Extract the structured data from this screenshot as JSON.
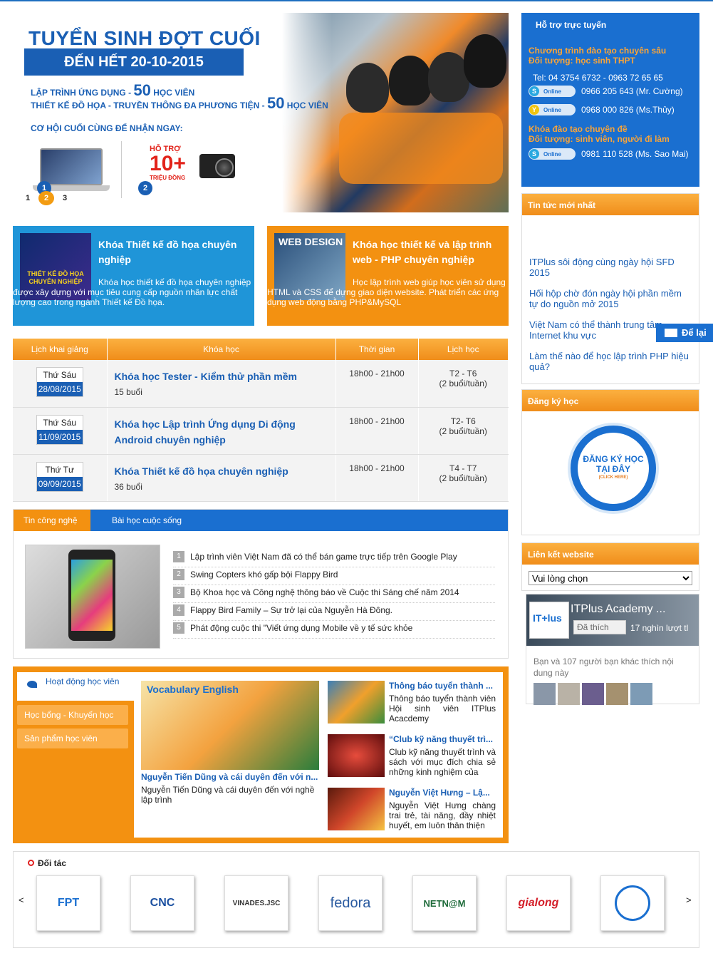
{
  "banner": {
    "title": "TUYỂN SINH ĐỢT CUỐI",
    "deadline": "ĐẾN HẾT 20-10-2015",
    "line1_prefix": "LẬP TRÌNH ỨNG DỤNG - ",
    "line1_num": "50",
    "line1_suffix": " HỌC VIÊN",
    "line2_prefix": "THIẾT KẾ ĐỒ HỌA - TRUYỀN THÔNG ĐA PHƯƠNG TIỆN - ",
    "line2_num": "50",
    "line2_suffix": " HỌC VIÊN",
    "chance": "CƠ HỘI CUỐI CÙNG ĐỂ NHẬN NGAY:",
    "gift1_num": "1",
    "gift2_num": "2",
    "support_text": "HỖ TRỢ",
    "support_amount": "10+",
    "support_unit": "TRIỆU ĐỒNG",
    "pager": [
      "1",
      "2",
      "3"
    ]
  },
  "support": {
    "title": "Hỗ trợ trực tuyến",
    "program1": "Chương trình đào tạo chuyên sâu",
    "target1": "Đối tượng: học sinh THPT",
    "tel": "Tel: 04 3754 6732 - 0963 72 65 65",
    "badge": "Online",
    "contact1": "0966 205 643 (Mr. Cường)",
    "contact2": "0968 000 826 (Ms.Thủy)",
    "program2": "Khóa đào tạo chuyên đề",
    "target2": "Đối tượng: sinh viên, người đi làm",
    "contact3": "0981 110 528 (Ms. Sao Mai)"
  },
  "news": {
    "title": "Tin tức mới nhất",
    "items": [
      "ITPlus sôi động cùng ngày hội SFD 2015",
      "Hối hộp chờ đón ngày hội phần mềm tự do nguồn mở 2015",
      "Việt Nam có thể thành trung tâm Internet khu vực",
      "Làm thế nào để học lập trình PHP hiệu quả?"
    ]
  },
  "send": {
    "label": "Để lại"
  },
  "register": {
    "title": "Đăng ký học",
    "button_line1": "ĐĂNG KÝ HỌC",
    "button_line2": "TẠI ĐÂY",
    "button_sub": "(CLICK HERE)"
  },
  "links": {
    "title": "Liên kết website",
    "select_value": "Vui lòng chọn"
  },
  "facebook": {
    "logo": "IT+lus",
    "name": "ITPlus Academy ...",
    "like": "Đã thích",
    "count": "17 nghìn lượt tl",
    "friends": "Bạn và 107 người bạn khác thích nội dung này"
  },
  "promo": [
    {
      "img_text": "THIẾT KẾ ĐỒ HỌA CHUYÊN NGHIỆP",
      "title": "Khóa Thiết kế đồ họa chuyên nghiệp",
      "desc": "Khóa học thiết kế đồ họa chuyên nghiệp được xây dựng với mục tiêu cung cấp nguồn nhân lực chất lượng cao trong ngành Thiết kế Đồ họa."
    },
    {
      "img_text": "WEB DESIGN",
      "title": "Khóa học thiết kế và lập trình web - PHP chuyên nghiệp",
      "desc": "Học lập trình web giúp học viên sử dụng HTML và CSS để dựng giao diện website. Phát triển các ứng dụng web động bằng PHP&MySQL"
    }
  ],
  "schedule": {
    "headers": [
      "Lịch khai giảng",
      "Khóa học",
      "Thời gian",
      "Lịch học"
    ],
    "rows": [
      {
        "day": "Thứ Sáu",
        "date": "28/08/2015",
        "course": "Khóa học Tester - Kiểm thử phần mềm",
        "sessions": "15 buổi",
        "time": "18h00 - 21h00",
        "days": "T2 - T6",
        "freq": "(2 buổi/tuần)"
      },
      {
        "day": "Thứ Sáu",
        "date": "11/09/2015",
        "course": "Khóa học Lập trình Ứng dụng Di động Android chuyên nghiệp",
        "sessions": "",
        "time": "18h00 - 21h00",
        "days": "T2- T6",
        "freq": "(2 buổi/tuần)"
      },
      {
        "day": "Thứ Tư",
        "date": "09/09/2015",
        "course": "Khóa Thiết kế đồ họa chuyên nghiệp",
        "sessions": "36 buổi",
        "time": "18h00 - 21h00",
        "days": "T4 - T7",
        "freq": "(2 buổi/tuần)"
      }
    ]
  },
  "tech": {
    "tab1": "Tin công nghệ",
    "tab2": "Bài học cuộc sống",
    "items": [
      "Lập trình viên Việt Nam đã có thể bán game trực tiếp trên Google Play",
      "Swing Copters khó gấp bội Flappy Bird",
      "Bộ Khoa học và Công nghệ thông báo về Cuộc thi Sáng chế năm 2014",
      "Flappy Bird Family – Sự trở lại của Nguyễn Hà Đông.",
      "Phát động cuộc thi \"Viết ứng dụng Mobile về y tế sức khỏe"
    ]
  },
  "activities": {
    "tab_active": "Hoạt động học viên",
    "tab2": "Học bổng - Khuyến học",
    "tab3": "Sản phẩm học viên",
    "feature_image_text": "Vocabulary English",
    "feature_title": "Nguyễn Tiến Dũng và cái duyên đến với n...",
    "feature_desc": "Nguyễn Tiến Dũng và cái duyên đến với nghề lập trình",
    "items": [
      {
        "title": "Thông báo tuyển thành ...",
        "desc": "Thông báo tuyển thành viên Hội sinh viên ITPlus Acacdemy"
      },
      {
        "title": "“Club kỹ năng thuyết trì...",
        "desc": "Club kỹ năng thuyết trình và sách với mục đích chia sẻ những kinh nghiệm của"
      },
      {
        "title": "Nguyễn Việt Hưng – Lậ...",
        "desc": "Nguyễn Việt Hưng chàng trai trẻ, tài năng, đầy nhiệt huyết, em luôn thân thiện"
      }
    ]
  },
  "partners": {
    "title": "Đối tác",
    "prev": "<",
    "next": ">",
    "logos": [
      "FPT",
      "CNC",
      "VINADES.JSC",
      "fedora",
      "NETN@M",
      "gialong",
      "seal"
    ]
  },
  "colors": {
    "blue": "#1a6fd0",
    "orange": "#f39111",
    "dark_blue": "#1a5fb4"
  }
}
